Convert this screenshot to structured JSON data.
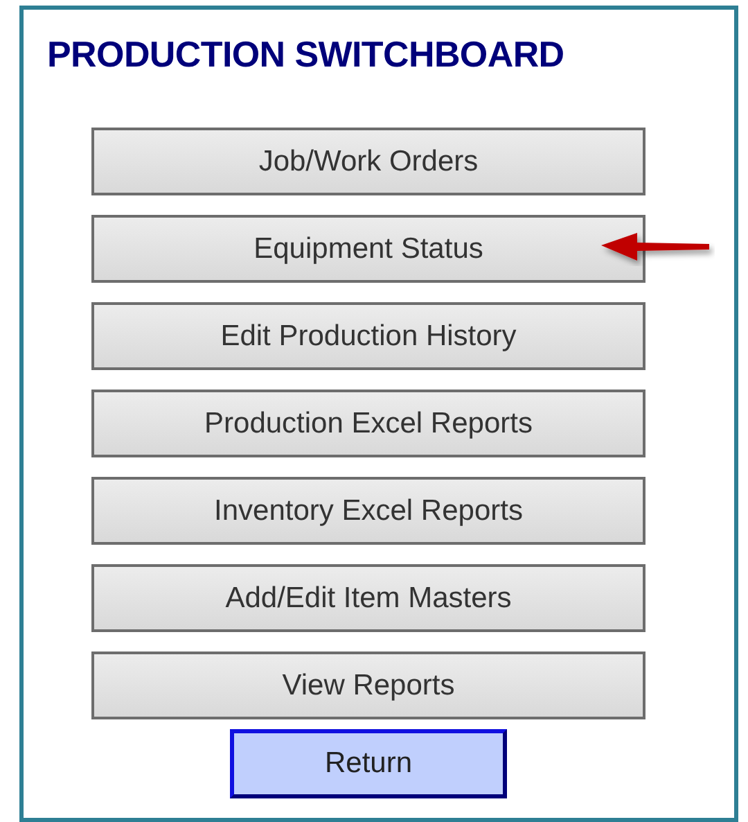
{
  "title": "PRODUCTION SWITCHBOARD",
  "buttons": [
    {
      "label": "Job/Work Orders",
      "marked": false
    },
    {
      "label": "Equipment Status",
      "marked": true
    },
    {
      "label": "Edit Production History",
      "marked": false
    },
    {
      "label": "Production Excel Reports",
      "marked": false
    },
    {
      "label": "Inventory Excel Reports",
      "marked": false
    },
    {
      "label": "Add/Edit Item Masters",
      "marked": false
    },
    {
      "label": "View Reports",
      "marked": false
    }
  ],
  "return_button": {
    "label": "Return"
  }
}
